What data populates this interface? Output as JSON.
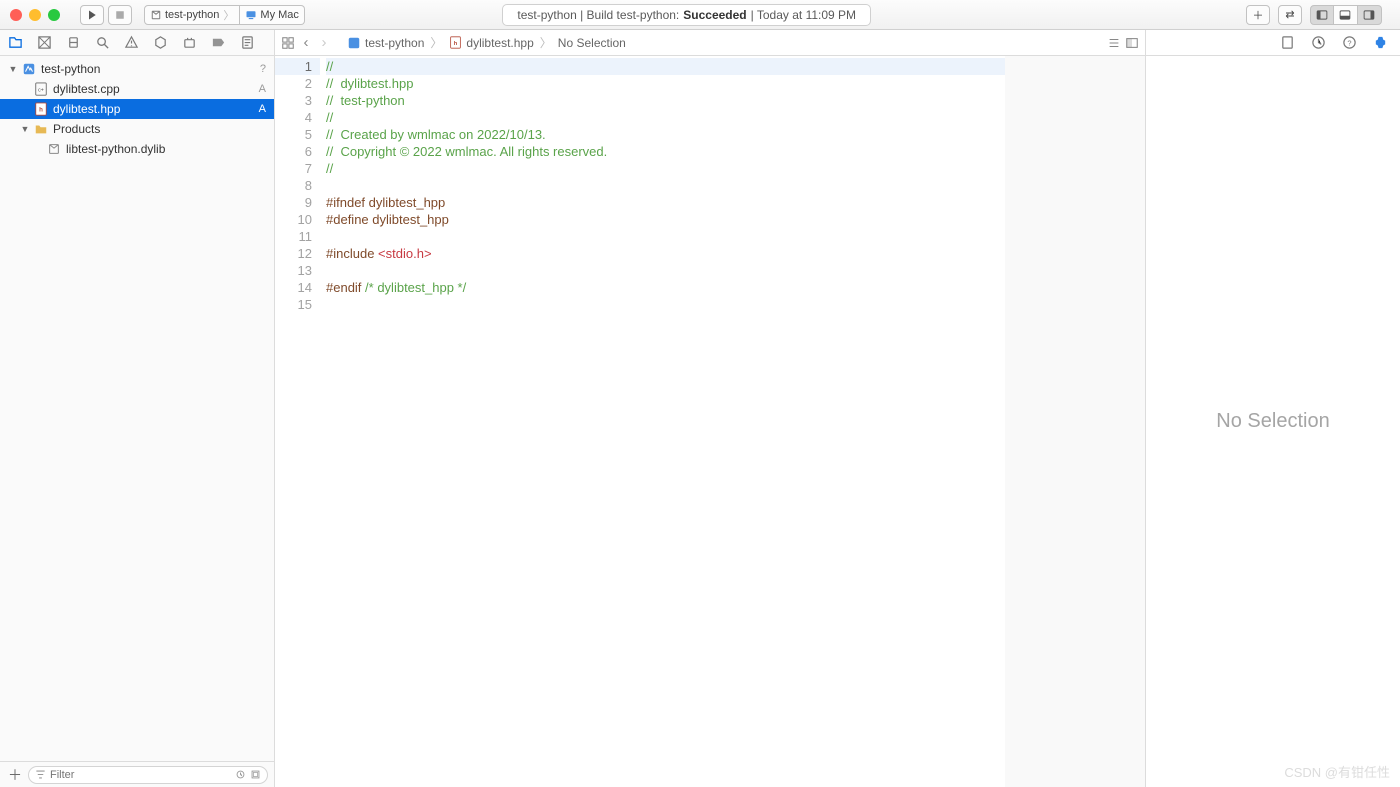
{
  "toolbar": {
    "scheme_project": "test-python",
    "scheme_device": "My Mac",
    "status_prefix": "test-python | Build test-python: ",
    "status_result": "Succeeded",
    "status_time": " | Today at 11:09 PM"
  },
  "navigator": {
    "project": "test-python",
    "project_badge": "?",
    "files": [
      {
        "name": "dylibtest.cpp",
        "badge": "A",
        "type": "cpp",
        "selected": false
      },
      {
        "name": "dylibtest.hpp",
        "badge": "A",
        "type": "hpp",
        "selected": true
      }
    ],
    "products_folder": "Products",
    "products": [
      {
        "name": "libtest-python.dylib",
        "type": "dylib"
      }
    ],
    "filter_placeholder": "Filter"
  },
  "jumpbar": {
    "items": [
      "test-python",
      "dylibtest.hpp",
      "No Selection"
    ]
  },
  "code": {
    "lines": [
      {
        "n": 1,
        "cls": "c-comment",
        "text": "//",
        "current": true
      },
      {
        "n": 2,
        "cls": "c-comment",
        "text": "//  dylibtest.hpp"
      },
      {
        "n": 3,
        "cls": "c-comment",
        "text": "//  test-python"
      },
      {
        "n": 4,
        "cls": "c-comment",
        "text": "//"
      },
      {
        "n": 5,
        "cls": "c-comment",
        "text": "//  Created by wmlmac on 2022/10/13."
      },
      {
        "n": 6,
        "cls": "c-comment",
        "text": "//  Copyright © 2022 wmlmac. All rights reserved."
      },
      {
        "n": 7,
        "cls": "c-comment",
        "text": "//"
      },
      {
        "n": 8,
        "cls": "c-plain",
        "text": ""
      },
      {
        "n": 9,
        "cls": "c-pre",
        "text": "#ifndef dylibtest_hpp"
      },
      {
        "n": 10,
        "cls": "c-pre",
        "text": "#define dylibtest_hpp"
      },
      {
        "n": 11,
        "cls": "c-plain",
        "text": ""
      },
      {
        "n": 12,
        "cls": "mixed",
        "pre": "#include ",
        "str": "<stdio.h>"
      },
      {
        "n": 13,
        "cls": "c-plain",
        "text": ""
      },
      {
        "n": 14,
        "cls": "mixed2",
        "pre": "#endif ",
        "comment": "/* dylibtest_hpp */"
      },
      {
        "n": 15,
        "cls": "c-plain",
        "text": ""
      }
    ]
  },
  "inspector": {
    "no_selection": "No Selection"
  },
  "watermark": "CSDN @有钳任性"
}
